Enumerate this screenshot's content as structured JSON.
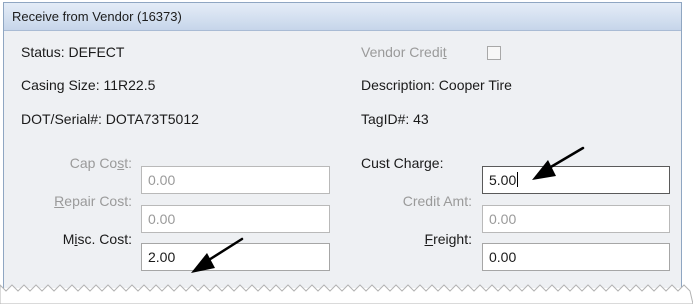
{
  "window": {
    "title": "Receive from Vendor (16373)"
  },
  "info": {
    "status": "Status:  DEFECT",
    "vendor_credit_pre": "Vendor Credi",
    "vendor_credit_key": "t",
    "casing_size": "Casing Size:  11R22.5",
    "description": "Description:  Cooper Tire",
    "dot_serial": "DOT/Serial#:  DOTA73T5012",
    "tag_id": "TagID#:  43"
  },
  "fields": {
    "cap_cost": {
      "pre": "Cap Co",
      "key": "s",
      "post": "t:",
      "value": "0.00"
    },
    "cust_charge": {
      "label": "Cust Charge:",
      "value": "5.00"
    },
    "repair_cost": {
      "key": "R",
      "post": "epair Cost:",
      "value": "0.00"
    },
    "credit_amt": {
      "label": "Credit Amt:",
      "value": "0.00"
    },
    "misc_cost": {
      "pre": "M",
      "key": "i",
      "post": "sc. Cost:",
      "value": "2.00"
    },
    "freight": {
      "key": "F",
      "post": "reight:",
      "value": "0.00"
    }
  },
  "colors": {
    "title_bar": "#d4e0f0",
    "panel": "#eef0f3",
    "disabled_text": "#9a9a9a"
  }
}
